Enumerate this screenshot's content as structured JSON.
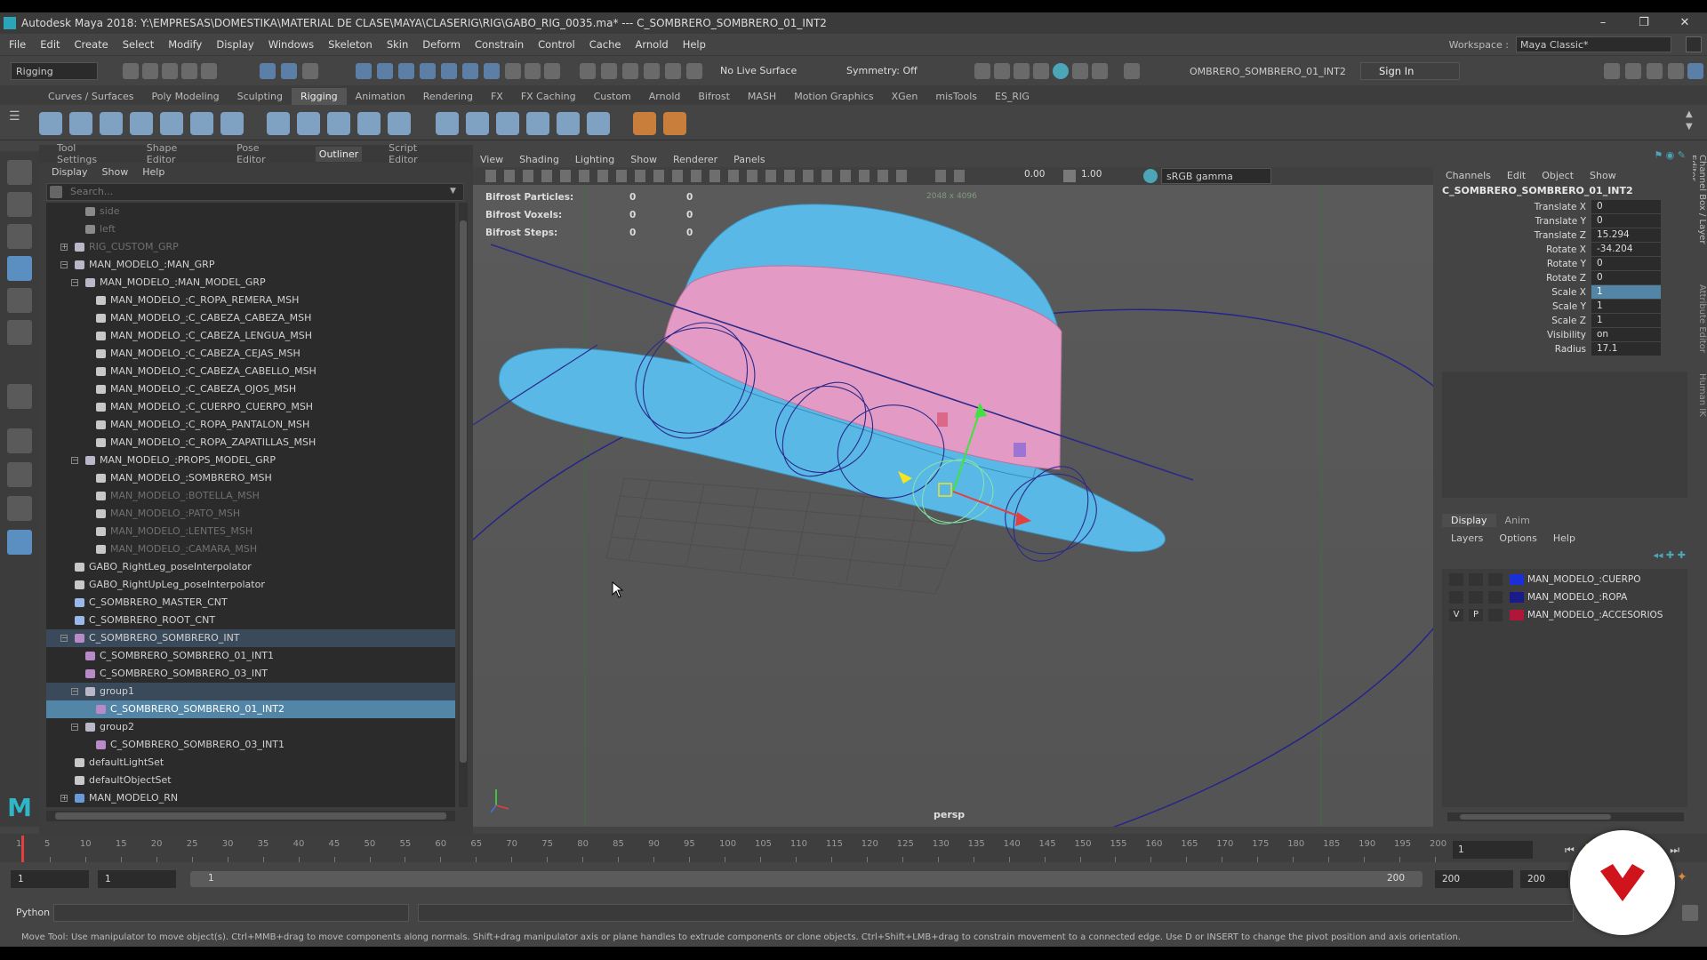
{
  "window": {
    "title": "Autodesk Maya 2018: Y:\\EMPRESAS\\DOMESTIKA\\MATERIAL DE CLASE\\MAYA\\CLASERIG\\RIG\\GABO_RIG_0035.ma*   ---   C_SOMBRERO_SOMBRERO_01_INT2",
    "controls": [
      "–",
      "❐",
      "✕"
    ]
  },
  "menubar": {
    "items": [
      "File",
      "Edit",
      "Create",
      "Select",
      "Modify",
      "Display",
      "Windows",
      "Skeleton",
      "Skin",
      "Deform",
      "Constrain",
      "Control",
      "Cache",
      "Arnold",
      "Help"
    ],
    "workspace_label": "Workspace :",
    "workspace_value": "Maya Classic*"
  },
  "statusline": {
    "menuset": "Rigging",
    "live_surface": "No Live Surface",
    "symmetry": "Symmetry: Off",
    "object_field": "OMBRERO_SOMBRERO_01_INT2",
    "sign_in": "Sign In"
  },
  "shelf": {
    "tabs": [
      "Curves / Surfaces",
      "Poly Modeling",
      "Sculpting",
      "Rigging",
      "Animation",
      "Rendering",
      "FX",
      "FX Caching",
      "Custom",
      "Arnold",
      "Bifrost",
      "MASH",
      "Motion Graphics",
      "XGen",
      "misTools",
      "ES_RIG"
    ],
    "active_tab": "Rigging"
  },
  "outliner": {
    "panel_tabs": [
      "Tool Settings",
      "Shape Editor",
      "Pose Editor",
      "Outliner",
      "Script Editor"
    ],
    "active_tab": "Outliner",
    "menu": [
      "Display",
      "Show",
      "Help"
    ],
    "search_placeholder": "Search...",
    "rows": [
      {
        "label": "side",
        "indent": 2,
        "icon": "camera",
        "dim": true
      },
      {
        "label": "left",
        "indent": 2,
        "icon": "camera",
        "dim": true
      },
      {
        "label": "RIG_CUSTOM_GRP",
        "indent": 1,
        "icon": "group",
        "dim": true,
        "expand": "+"
      },
      {
        "label": "MAN_MODELO_:MAN_GRP",
        "indent": 1,
        "icon": "group",
        "expand": "−"
      },
      {
        "label": "MAN_MODELO_:MAN_MODEL_GRP",
        "indent": 2,
        "icon": "group",
        "expand": "−"
      },
      {
        "label": "MAN_MODELO_:C_ROPA_REMERA_MSH",
        "indent": 3,
        "icon": "mesh"
      },
      {
        "label": "MAN_MODELO_:C_CABEZA_CABEZA_MSH",
        "indent": 3,
        "icon": "mesh"
      },
      {
        "label": "MAN_MODELO_:C_CABEZA_LENGUA_MSH",
        "indent": 3,
        "icon": "mesh"
      },
      {
        "label": "MAN_MODELO_:C_CABEZA_CEJAS_MSH",
        "indent": 3,
        "icon": "mesh"
      },
      {
        "label": "MAN_MODELO_:C_CABEZA_CABELLO_MSH",
        "indent": 3,
        "icon": "mesh"
      },
      {
        "label": "MAN_MODELO_:C_CABEZA_OJOS_MSH",
        "indent": 3,
        "icon": "mesh"
      },
      {
        "label": "MAN_MODELO_:C_CUERPO_CUERPO_MSH",
        "indent": 3,
        "icon": "mesh"
      },
      {
        "label": "MAN_MODELO_:C_ROPA_PANTALON_MSH",
        "indent": 3,
        "icon": "mesh"
      },
      {
        "label": "MAN_MODELO_:C_ROPA_ZAPATILLAS_MSH",
        "indent": 3,
        "icon": "mesh"
      },
      {
        "label": "MAN_MODELO_:PROPS_MODEL_GRP",
        "indent": 2,
        "icon": "group",
        "expand": "−"
      },
      {
        "label": "MAN_MODELO_:SOMBRERO_MSH",
        "indent": 3,
        "icon": "mesh"
      },
      {
        "label": "MAN_MODELO_:BOTELLA_MSH",
        "indent": 3,
        "icon": "mesh",
        "dim": true
      },
      {
        "label": "MAN_MODELO_:PATO_MSH",
        "indent": 3,
        "icon": "mesh",
        "dim": true
      },
      {
        "label": "MAN_MODELO_:LENTES_MSH",
        "indent": 3,
        "icon": "mesh",
        "dim": true
      },
      {
        "label": "MAN_MODELO_:CAMARA_MSH",
        "indent": 3,
        "icon": "mesh",
        "dim": true
      },
      {
        "label": "GABO_RightLeg_poseInterpolator",
        "indent": 1,
        "icon": "pose"
      },
      {
        "label": "GABO_RightUpLeg_poseInterpolator",
        "indent": 1,
        "icon": "pose"
      },
      {
        "label": "C_SOMBRERO_MASTER_CNT",
        "indent": 1,
        "icon": "curve"
      },
      {
        "label": "C_SOMBRERO_ROOT_CNT",
        "indent": 1,
        "icon": "curve"
      },
      {
        "label": "C_SOMBRERO_SOMBRERO_INT",
        "indent": 1,
        "icon": "joint",
        "expand": "−",
        "parent": true
      },
      {
        "label": "C_SOMBRERO_SOMBRERO_01_INT1",
        "indent": 2,
        "icon": "joint"
      },
      {
        "label": "C_SOMBRERO_SOMBRERO_03_INT",
        "indent": 2,
        "icon": "joint"
      },
      {
        "label": "group1",
        "indent": 2,
        "icon": "group",
        "expand": "−",
        "parent": true
      },
      {
        "label": "C_SOMBRERO_SOMBRERO_01_INT2",
        "indent": 3,
        "icon": "joint",
        "selected": true
      },
      {
        "label": "group2",
        "indent": 2,
        "icon": "group",
        "expand": "−"
      },
      {
        "label": "C_SOMBRERO_SOMBRERO_03_INT1",
        "indent": 3,
        "icon": "joint"
      },
      {
        "label": "defaultLightSet",
        "indent": 1,
        "icon": "set"
      },
      {
        "label": "defaultObjectSet",
        "indent": 1,
        "icon": "set"
      },
      {
        "label": "MAN_MODELO_RN",
        "indent": 1,
        "icon": "ref",
        "expand": "+"
      }
    ]
  },
  "viewport": {
    "menu": [
      "View",
      "Shading",
      "Lighting",
      "Show",
      "Renderer",
      "Panels"
    ],
    "exposure": "0.00",
    "gamma": "1.00",
    "color_space": "sRGB gamma",
    "hud": [
      {
        "label": "Bifrost Particles:",
        "a": "0",
        "b": "0"
      },
      {
        "label": "Bifrost Voxels:",
        "a": "0",
        "b": "0"
      },
      {
        "label": "Bifrost Steps:",
        "a": "0",
        "b": "0"
      }
    ],
    "resolution": "2048 x 4096",
    "camera": "persp"
  },
  "channelbox": {
    "menu": [
      "Channels",
      "Edit",
      "Object",
      "Show"
    ],
    "node": "C_SOMBRERO_SOMBRERO_01_INT2",
    "attrs": [
      {
        "name": "Translate X",
        "value": "0"
      },
      {
        "name": "Translate Y",
        "value": "0"
      },
      {
        "name": "Translate Z",
        "value": "15.294"
      },
      {
        "name": "Rotate X",
        "value": "-34.204"
      },
      {
        "name": "Rotate Y",
        "value": "0"
      },
      {
        "name": "Rotate Z",
        "value": "0"
      },
      {
        "name": "Scale X",
        "value": "1",
        "highlight": true
      },
      {
        "name": "Scale Y",
        "value": "1"
      },
      {
        "name": "Scale Z",
        "value": "1"
      },
      {
        "name": "Visibility",
        "value": "on"
      },
      {
        "name": "Radius",
        "value": "17.1"
      }
    ],
    "side_tabs": [
      "Channel Box / Layer Editor",
      "Attribute Editor",
      "Human IK"
    ]
  },
  "layers": {
    "tabs": [
      "Display",
      "Anim"
    ],
    "active_tab": "Display",
    "menu": [
      "Layers",
      "Options",
      "Help"
    ],
    "items": [
      {
        "name": "MAN_MODELO_:CUERPO",
        "color": "#1a2fd8",
        "v": "",
        "p": ""
      },
      {
        "name": "MAN_MODELO_:ROPA",
        "color": "#1a1a8a",
        "v": "",
        "p": ""
      },
      {
        "name": "MAN_MODELO_:ACCESORIOS",
        "color": "#b0163a",
        "v": "V",
        "p": "P"
      }
    ]
  },
  "timeline": {
    "ticks": [
      "1",
      "5",
      "10",
      "15",
      "20",
      "25",
      "30",
      "35",
      "40",
      "45",
      "50",
      "55",
      "60",
      "65",
      "70",
      "75",
      "80",
      "85",
      "90",
      "95",
      "100",
      "105",
      "110",
      "115",
      "120",
      "125",
      "130",
      "135",
      "140",
      "145",
      "150",
      "155",
      "160",
      "165",
      "170",
      "175",
      "180",
      "185",
      "190",
      "195",
      "200"
    ],
    "current_frame": "1"
  },
  "range": {
    "start": "1",
    "playback_start": "1",
    "slider_start": "1",
    "slider_end": "200",
    "playback_end": "200",
    "end": "200"
  },
  "command": {
    "language": "Python"
  },
  "helpline": "Move Tool: Use manipulator to move object(s). Ctrl+MMB+drag to move components along normals. Shift+drag manipulator axis or plane handles to extrude components or clone objects. Ctrl+Shift+LMB+drag to constrain movement to a connected edge. Use D or INSERT to change the pivot position and axis orientation.",
  "colors": {
    "hat_blue": "#5ab8e6",
    "hat_band": "#e39ac4",
    "wire": "#2a2a8a",
    "selection": "#5285a6",
    "logo_red": "#d0141c"
  }
}
